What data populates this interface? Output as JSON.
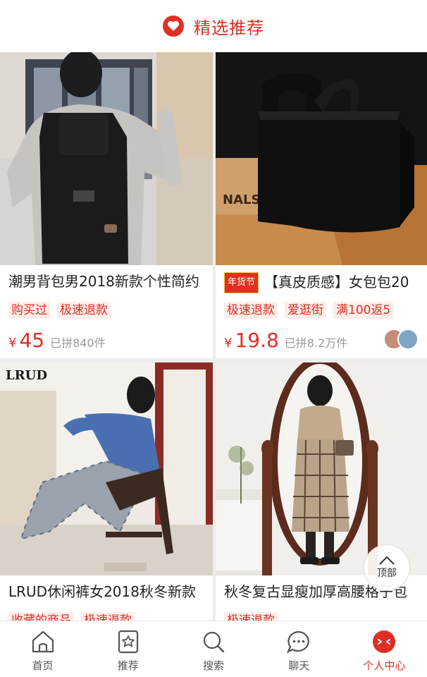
{
  "header": {
    "title": "精选推荐",
    "icon": "heart-icon",
    "accent": "#e02e24"
  },
  "products": [
    {
      "name": "潮男背包男2018新款个性简约",
      "tags": [
        "购买过",
        "极速退款"
      ],
      "currency": "¥",
      "price": "45",
      "sold": "已拼840件",
      "image": "backpack-photo"
    },
    {
      "badge": "年货节",
      "name": "【真皮质感】女包包20",
      "tags": [
        "极速退款",
        "爱逛街",
        "满100返5"
      ],
      "currency": "¥",
      "price": "19.8",
      "sold": "已拼8.2万件",
      "image": "handbag-photo",
      "image_text": "NALS"
    },
    {
      "name": "LRUD休闲裤女2018秋冬新款",
      "tags": [
        "收藏的商品",
        "极速退款"
      ],
      "image": "pants-photo",
      "image_text": "LRUD"
    },
    {
      "name": "秋冬复古显瘦加厚高腰格子包",
      "tags": [
        "极速退款"
      ],
      "image": "skirt-photo"
    }
  ],
  "back_to_top": {
    "label": "顶部"
  },
  "tabbar": {
    "items": [
      {
        "label": "首页",
        "icon": "home-icon"
      },
      {
        "label": "推荐",
        "icon": "star-bookmark-icon"
      },
      {
        "label": "搜索",
        "icon": "search-icon"
      },
      {
        "label": "聊天",
        "icon": "chat-icon"
      },
      {
        "label": "个人中心",
        "icon": "profile-icon",
        "active": true
      }
    ]
  }
}
